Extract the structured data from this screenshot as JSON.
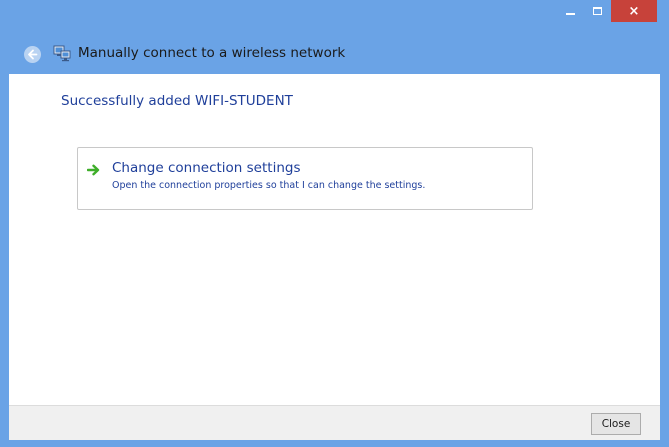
{
  "window": {
    "controls": {
      "minimize_icon": "minimize-icon",
      "maximize_icon": "maximize-icon",
      "close_glyph": "×",
      "close_color": "#c7423a"
    }
  },
  "nav": {
    "title": "Manually connect to a wireless network",
    "back_icon": "back-arrow-icon",
    "network_icon": "network-icon"
  },
  "main": {
    "success_message": "Successfully added WIFI-STUDENT",
    "option": {
      "icon": "green-arrow-icon",
      "title": "Change connection settings",
      "description": "Open the connection properties so that I can change the settings."
    }
  },
  "footer": {
    "close_label": "Close"
  },
  "colors": {
    "frame": "#6aa3e6",
    "link_text": "#1f3f9a",
    "arrow": "#3fae2a"
  }
}
